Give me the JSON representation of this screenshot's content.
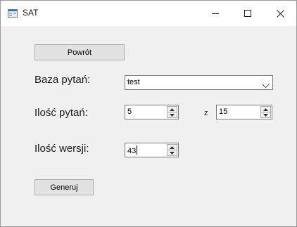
{
  "window": {
    "title": "SAT",
    "icons": {
      "app": "form-icon",
      "minimize": "minimize-icon",
      "maximize": "maximize-icon",
      "close": "close-icon"
    }
  },
  "form": {
    "back_button": "Powrót",
    "question_base": {
      "label": "Baza pytań:",
      "selected": "test",
      "dropdown_icon": "chevron-down-icon"
    },
    "question_count": {
      "label": "Ilość pytań:",
      "value": "5",
      "of_label": "z",
      "total": "15"
    },
    "version_count": {
      "label": "Ilość wersji:",
      "value": "43"
    },
    "generate_button": "Generuj"
  },
  "colors": {
    "window_background": "#f0f0f0",
    "titlebar_background": "#ffffff",
    "button_face": "#e1e1e1",
    "button_border": "#adadad",
    "input_border": "#7a7a7a"
  }
}
